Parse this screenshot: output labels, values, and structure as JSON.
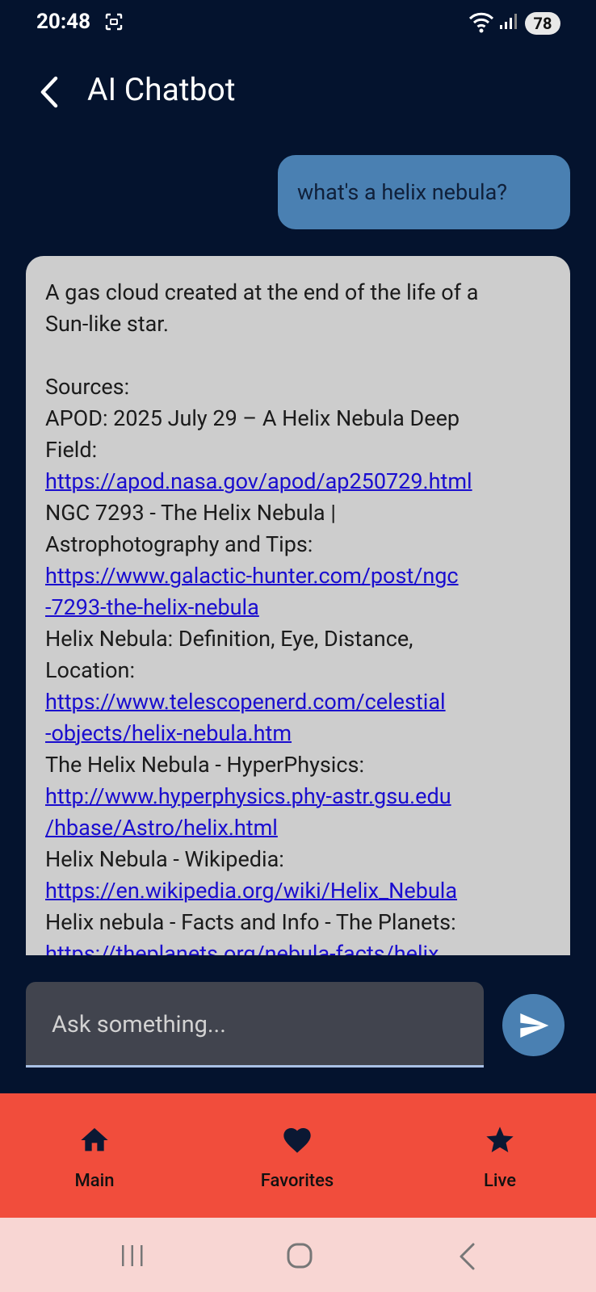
{
  "status_bar": {
    "time": "20:48",
    "battery": "78",
    "icons": [
      "screenshot-icon",
      "wifi-icon",
      "signal-icon"
    ]
  },
  "header": {
    "title": "AI Chatbot",
    "back_icon": "back-arrow-icon"
  },
  "chat": {
    "user_message": "what's a helix nebula?",
    "bot_lines": [
      {
        "text": "A gas cloud created at the end of the life of a",
        "type": "text"
      },
      {
        "text": "Sun-like star.",
        "type": "text"
      },
      {
        "text": "",
        "type": "blank"
      },
      {
        "text": "Sources:",
        "type": "text"
      },
      {
        "text": "APOD: 2025 July 29 – A Helix Nebula Deep",
        "type": "text"
      },
      {
        "text": "Field:",
        "type": "text"
      },
      {
        "text": "https://apod.nasa.gov/apod/ap250729.html",
        "type": "link"
      },
      {
        "text": "NGC 7293 - The Helix Nebula |",
        "type": "text"
      },
      {
        "text": "Astrophotography and Tips:",
        "type": "text"
      },
      {
        "text": "https://www.galactic-hunter.com/post/ngc",
        "type": "link"
      },
      {
        "text": "-7293-the-helix-nebula",
        "type": "link"
      },
      {
        "text": "Helix Nebula: Definition, Eye, Distance,",
        "type": "text"
      },
      {
        "text": "Location:",
        "type": "text"
      },
      {
        "text": "https://www.telescopenerd.com/celestial",
        "type": "link"
      },
      {
        "text": "-objects/helix-nebula.htm",
        "type": "link"
      },
      {
        "text": "The Helix Nebula - HyperPhysics:",
        "type": "text"
      },
      {
        "text": "http://www.hyperphysics.phy-astr.gsu.edu",
        "type": "link"
      },
      {
        "text": "/hbase/Astro/helix.html",
        "type": "link"
      },
      {
        "text": "Helix Nebula - Wikipedia:",
        "type": "text"
      },
      {
        "text": "https://en.wikipedia.org/wiki/Helix_Nebula",
        "type": "link"
      },
      {
        "text": "Helix nebula - Facts and Info - The Planets:",
        "type": "text"
      },
      {
        "text": "https://theplanets.org/nebula-facts/helix",
        "type": "link"
      }
    ]
  },
  "input": {
    "placeholder": "Ask something...",
    "value": ""
  },
  "bottom_nav": {
    "items": [
      {
        "label": "Main",
        "icon": "home-icon"
      },
      {
        "label": "Favorites",
        "icon": "heart-icon"
      },
      {
        "label": "Live",
        "icon": "star-icon"
      }
    ]
  },
  "colors": {
    "background": "#04132e",
    "user_bubble": "#4a80b2",
    "bot_bubble": "#cdcdcd",
    "link": "#1a0dcf",
    "bottom_nav": "#f14d3c",
    "system_nav": "#f8d6d3"
  }
}
